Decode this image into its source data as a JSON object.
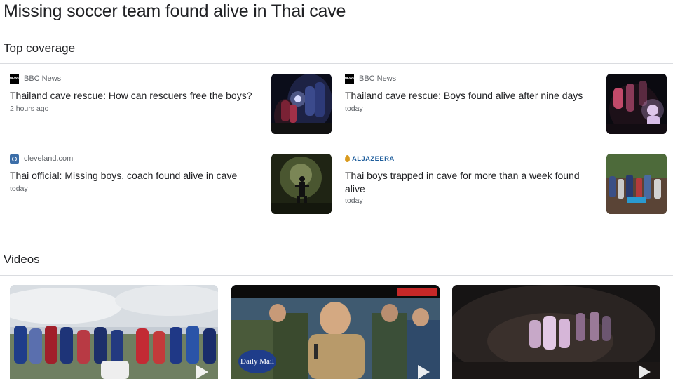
{
  "page": {
    "title": "Missing soccer team found alive in Thai cave"
  },
  "top_coverage": {
    "heading": "Top coverage",
    "articles": [
      {
        "source": "BBC News",
        "logo_icon": "bbc-news-logo",
        "headline": "Thailand cave rescue: How can rescuers free the boys?",
        "age": "2 hours ago",
        "thumb_icon": "cave-divers-photo"
      },
      {
        "source": "BBC News",
        "logo_icon": "bbc-news-logo",
        "headline": "Thailand cave rescue: Boys found alive after nine days",
        "age": "today",
        "thumb_icon": "boys-in-cave-photo"
      },
      {
        "source": "cleveland.com",
        "logo_icon": "cleveland-logo",
        "headline": "Thai official: Missing boys, coach found alive in cave",
        "age": "today",
        "thumb_icon": "cave-silhouette-photo"
      },
      {
        "source": "ALJAZEERA",
        "logo_icon": "aljazeera-logo",
        "headline": "Thai boys trapped in cave for more than a week found alive",
        "age": "today",
        "thumb_icon": "rescue-crowd-photo"
      }
    ]
  },
  "videos": {
    "heading": "Videos",
    "items": [
      {
        "thumb_icon": "team-photo-video",
        "overlay_text": ""
      },
      {
        "thumb_icon": "press-conference-video",
        "overlay_text": "Daily Mail"
      },
      {
        "thumb_icon": "cave-boys-video",
        "overlay_text": ""
      }
    ]
  },
  "colors": {
    "text": "#202124",
    "secondary": "#5f6368",
    "divider": "#dadce0",
    "aljazeera": "#1f5e9c"
  }
}
